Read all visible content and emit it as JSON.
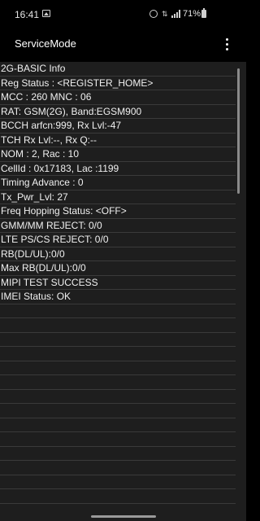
{
  "status_bar": {
    "time": "16:41",
    "battery": "71%",
    "icons": [
      "gallery-icon",
      "alarm-icon",
      "data-icon",
      "signal-icon",
      "battery-icon"
    ]
  },
  "app_bar": {
    "title": "ServiceMode",
    "overflow_icon": "more-vert-icon"
  },
  "info_lines": [
    "2G-BASIC Info",
    "Reg Status : <REGISTER_HOME>",
    "MCC : 260 MNC : 06",
    "RAT: GSM(2G), Band:EGSM900",
    "BCCH arfcn:999, Rx Lvl:-47",
    "TCH Rx Lvl:--, Rx Q:--",
    "NOM : 2, Rac : 10",
    "CellId : 0x17183, Lac :1199",
    "Timing Advance : 0",
    "Tx_Pwr_Lvl: 27",
    "Freq Hopping Status: <OFF>",
    "GMM/MM REJECT: 0/0",
    "LTE PS/CS REJECT: 0/0",
    "RB(DL/UL):0/0",
    "Max RB(DL/UL):0/0",
    "MIPI TEST SUCCESS",
    "IMEI Status: OK",
    "",
    "",
    "",
    "",
    "",
    "",
    "",
    "",
    "",
    "",
    "",
    "",
    "",
    "",
    ""
  ],
  "colors": {
    "background": "#1e1e1e",
    "app_bar": "#000000",
    "divider": "#3a3a3a",
    "text": "#f0f0f0"
  }
}
